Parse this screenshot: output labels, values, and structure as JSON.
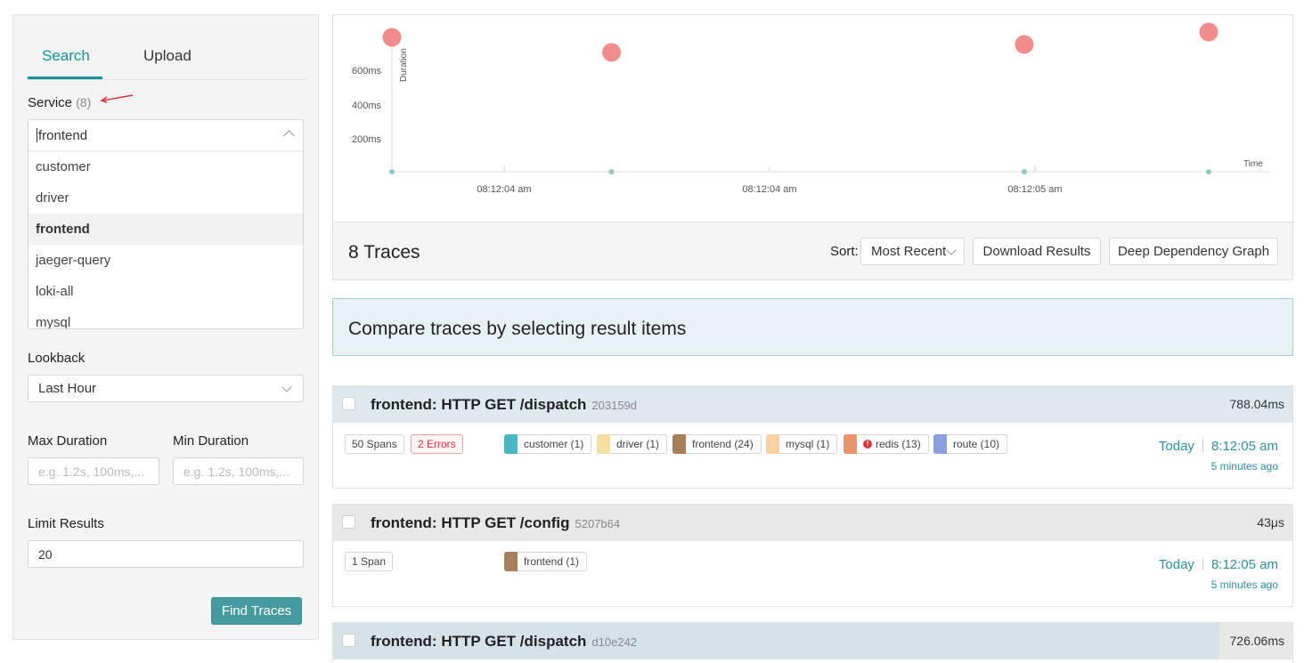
{
  "search": {
    "tabs": [
      {
        "label": "Search"
      },
      {
        "label": "Upload"
      }
    ],
    "service_label": "Service",
    "service_count": "(8)",
    "service_value": "frontend",
    "service_options": [
      "customer",
      "driver",
      "frontend",
      "jaeger-query",
      "loki-all",
      "mysql"
    ],
    "lookback_label": "Lookback",
    "lookback_value": "Last Hour",
    "max_duration_label": "Max Duration",
    "min_duration_label": "Min Duration",
    "duration_placeholder": "e.g. 1.2s, 100ms,...",
    "limit_label": "Limit Results",
    "limit_value": "20",
    "find_button": "Find Traces"
  },
  "chart": {
    "y_axis_label": "Duration",
    "x_axis_label": "Time",
    "y_ticks": [
      "200ms",
      "400ms",
      "600ms"
    ],
    "x_ticks": [
      "08:12:04 am",
      "08:12:04 am",
      "08:12:05 am"
    ],
    "point_color": "#f18d8c",
    "axis_dot_color": "#8ccbc3"
  },
  "chart_data": {
    "type": "scatter",
    "x_label": "Time",
    "y_label": "Duration",
    "y_unit": "ms",
    "ylim": [
      0,
      800
    ],
    "points": [
      {
        "t": 0.0,
        "y": 760
      },
      {
        "t": 0.25,
        "y": 675
      },
      {
        "t": 0.72,
        "y": 720
      },
      {
        "t": 0.93,
        "y": 790
      }
    ]
  },
  "results": {
    "count_label": "8 Traces",
    "sort_label": "Sort:",
    "sort_value": "Most Recent",
    "download_button": "Download Results",
    "ddg_button": "Deep Dependency Graph",
    "compare_banner": "Compare traces by selecting result items",
    "traces": [
      {
        "title": "frontend: HTTP GET /dispatch",
        "id": "203159d",
        "duration": "788.04ms",
        "spans": "50 Spans",
        "errors": "2 Errors",
        "services": [
          {
            "label": "customer (1)",
            "color": "#4cb7c4"
          },
          {
            "label": "driver (1)",
            "color": "#f6dea1"
          },
          {
            "label": "frontend (24)",
            "color": "#a67e5a"
          },
          {
            "label": "mysql (1)",
            "color": "#f9d2a4"
          },
          {
            "label": "redis (13)",
            "color": "#e9946d"
          },
          {
            "label": "route (10)",
            "color": "#8b9ee0"
          }
        ],
        "day": "Today",
        "time": "8:12:05 am",
        "ago": "5 minutes ago"
      },
      {
        "title": "frontend: HTTP GET /config",
        "id": "5207b64",
        "duration": "43μs",
        "spans": "1 Span",
        "services": [
          {
            "label": "frontend (1)",
            "color": "#a67e5a"
          }
        ],
        "day": "Today",
        "time": "8:12:05 am",
        "ago": "5 minutes ago"
      },
      {
        "title": "frontend: HTTP GET /dispatch",
        "id": "d10e242",
        "duration": "726.06ms"
      }
    ]
  }
}
